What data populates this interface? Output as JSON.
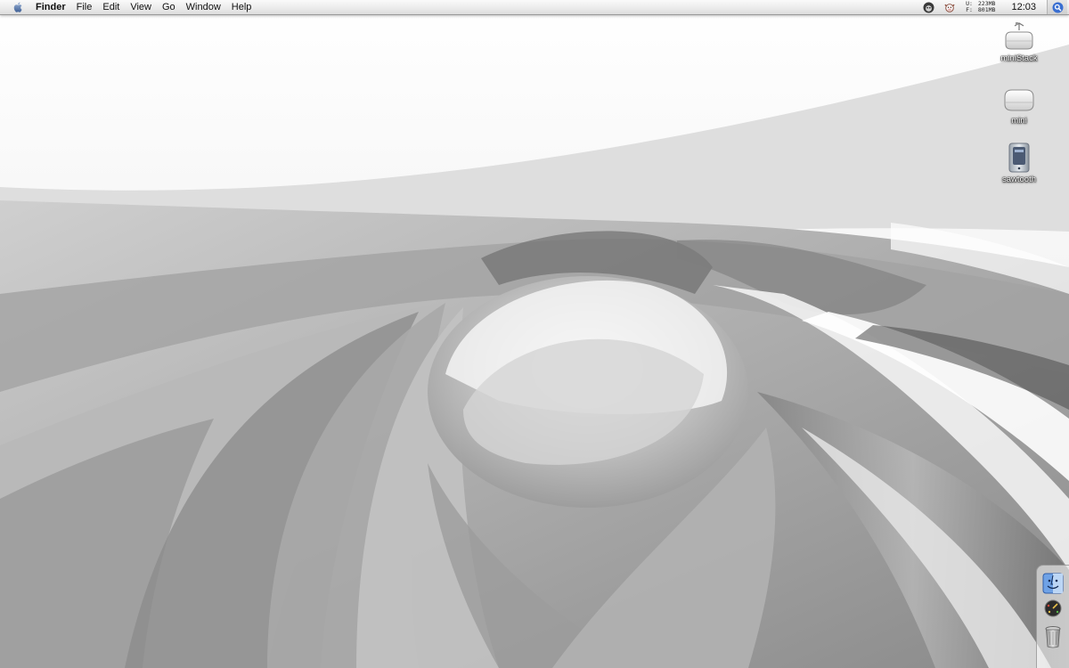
{
  "menubar": {
    "app_name": "Finder",
    "menus": [
      "File",
      "Edit",
      "View",
      "Go",
      "Window",
      "Help"
    ],
    "memory": {
      "used_label": "U:",
      "used_value": "223MB",
      "free_label": "F:",
      "free_value": "801MB"
    },
    "clock": "12:03",
    "status_icons": [
      "monkey-icon",
      "cow-icon",
      "spotlight-icon"
    ]
  },
  "desktop": {
    "icons": [
      {
        "label": "miniStack",
        "icon": "external-drive-icon"
      },
      {
        "label": "mini",
        "icon": "hard-drive-icon"
      },
      {
        "label": "sawtooth",
        "icon": "power-mac-g4-icon"
      }
    ]
  },
  "dock": {
    "items": [
      "finder-icon",
      "dashboard-icon",
      "trash-icon"
    ]
  },
  "colors": {
    "menubar_bg": "#ececec",
    "wallpaper_light": "#ffffff",
    "wallpaper_dark": "#5e5e5e",
    "spotlight_blue": "#3a6fd1"
  }
}
